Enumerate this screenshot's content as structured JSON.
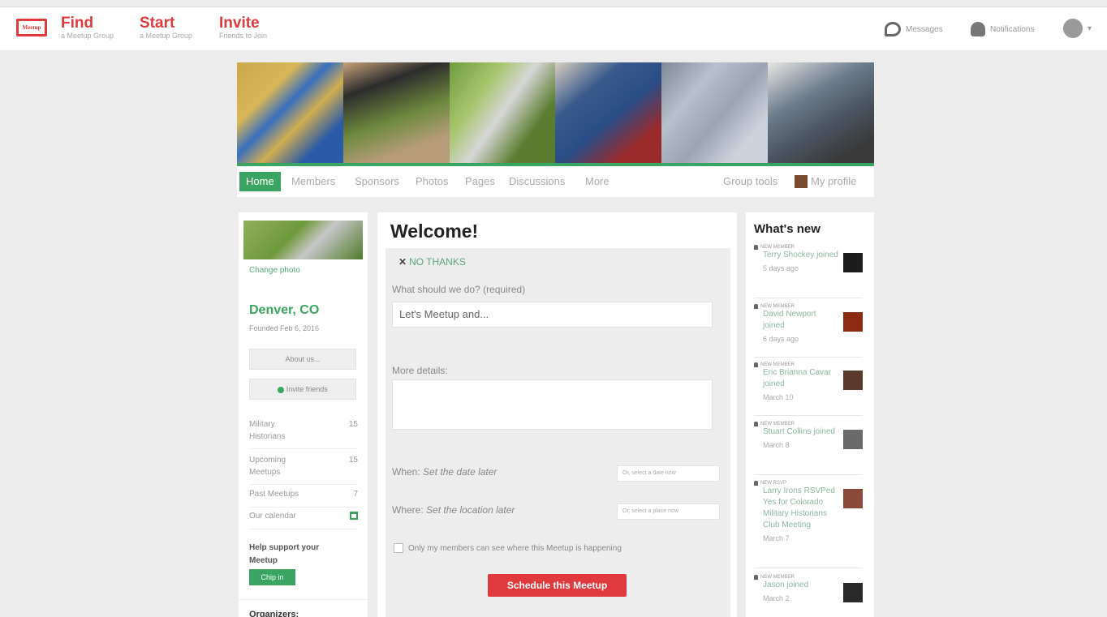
{
  "topnav": {
    "logo": "Meetup",
    "find": {
      "label": "Find",
      "sub": "a Meetup Group"
    },
    "start": {
      "label": "Start",
      "sub": "a Meetup Group"
    },
    "invite": {
      "label": "Invite",
      "sub": "Friends to Join"
    },
    "messages": "Messages",
    "notifications": "Notifications",
    "avatar_caret": "▾"
  },
  "colors": {
    "brand_red": "#e0393e",
    "green": "#3aa562"
  },
  "group_nav": {
    "tabs": [
      "Home",
      "Members",
      "Sponsors",
      "Photos",
      "Pages",
      "Discussions",
      "More"
    ],
    "group_tools": "Group tools",
    "my_profile": "My profile"
  },
  "left": {
    "change_photo": "Change photo",
    "city": "Denver, CO",
    "founded": "Founded Feb 6, 2016",
    "about_btn": "About us...",
    "invite_btn": "Invite friends",
    "stats": [
      {
        "label": "Military Historians",
        "value": "15"
      },
      {
        "label": "Upcoming Meetups",
        "value": "15"
      },
      {
        "label": "Past Meetups",
        "value": "7"
      },
      {
        "label": "Our calendar",
        "value": ""
      }
    ],
    "help": "Help support your Meetup",
    "chipin": "Chip in",
    "organizers": "Organizers:"
  },
  "main": {
    "welcome": "Welcome!",
    "no_thanks": "NO THANKS",
    "what_label": "What should we do? (required)",
    "what_value": "Let's Meetup and...",
    "details_label": "More details:",
    "when_label": "When:",
    "when_value": "Set the date later",
    "when_pick": "Or, select a date now",
    "where_label": "Where:",
    "where_value": "Set the location later",
    "where_pick": "Or, select a place now",
    "members_only": "Only my members can see where this Meetup is happening",
    "schedule_btn": "Schedule this Meetup"
  },
  "whats_new": {
    "title": "What's new",
    "items": [
      {
        "tag": "NEW MEMBER",
        "text": "Terry Shockey joined",
        "date": "5 days ago",
        "thumb": "#1d1d1d"
      },
      {
        "tag": "NEW MEMBER",
        "text": "David Newport joined",
        "date": "6 days ago",
        "thumb": "#8a2a10"
      },
      {
        "tag": "NEW MEMBER",
        "text": "Eric Brianna Cavar joined",
        "date": "March 10",
        "thumb": "#5a3a2a"
      },
      {
        "tag": "NEW MEMBER",
        "text": "Stuart Collins joined",
        "date": "March 8",
        "thumb": "#6a6a6a"
      },
      {
        "tag": "NEW RSVP",
        "text": "Larry Irons RSVPed Yes for Colorado Military Historians Club Meeting",
        "date": "March 7",
        "thumb": "#8a4a3a"
      },
      {
        "tag": "NEW MEMBER",
        "text": "Jason joined",
        "date": "March 2",
        "thumb": "#2a2a2a"
      }
    ]
  }
}
